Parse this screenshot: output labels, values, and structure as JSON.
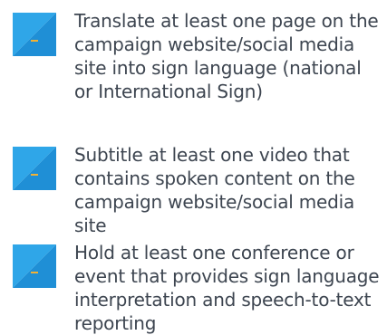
{
  "colors": {
    "icon_light": "#2fa6e8",
    "icon_dark": "#1f8fd6",
    "dash": "#f2b135",
    "text": "#3d4550"
  },
  "items": [
    {
      "icon": "checkbox-dash-icon",
      "text": "Translate at least one page on the campaign website/social media site into sign language (national or International Sign)"
    },
    {
      "icon": "checkbox-dash-icon",
      "text": "Subtitle at least one video that contains spoken content on the campaign website/social media site"
    },
    {
      "icon": "checkbox-dash-icon",
      "text": "Hold at least one conference or event that provides sign language interpretation and speech-to-text reporting"
    }
  ]
}
